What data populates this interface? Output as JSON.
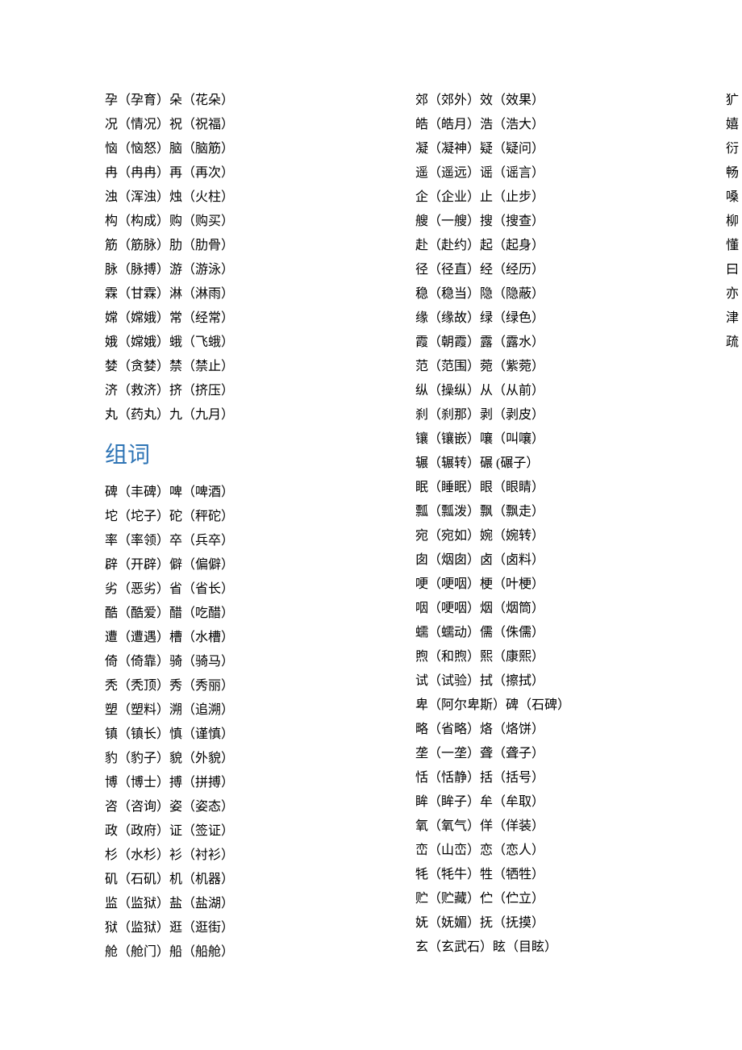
{
  "heading": "组词",
  "section1": [
    "孕（孕育）朵（花朵）",
    "况（情况）祝（祝福）",
    "恼（恼怒）脑（脑筋）",
    "冉（冉冉）再（再次）",
    "浊（浑浊）烛（火柱）",
    "构（构成）购（购买）",
    "筋（筋脉）肋（肋骨）",
    "脉（脉搏）游（游泳）",
    "霖（甘霖）淋（淋雨）",
    "嫦（嫦娥）常（经常）",
    "娥（嫦娥）蛾（飞蛾）",
    "婪（贪婪）禁（禁止）",
    "济（救济）挤（挤压）",
    "丸（药丸）九（九月）"
  ],
  "section2": [
    "碑（丰碑）啤（啤酒）",
    "坨（坨子）砣（秤砣）",
    "率（率领）卒（兵卒）",
    "辟（开辟）僻（偏僻）",
    "劣（恶劣）省（省长）",
    "酷（酷爱）醋（吃醋）",
    "遭（遭遇）槽（水槽）",
    "倚（倚靠）骑（骑马）",
    "秃（秃顶）秀（秀丽）",
    "塑（塑料）溯（追溯）",
    "镇（镇长）慎（谨慎）",
    "豹（豹子）貌（外貌）",
    "博（博士）搏（拼搏）",
    "咨（咨询）姿（姿态）",
    "政（政府）证（签证）",
    "杉（水杉）衫（衬衫）",
    "矶（石矶）机（机器）",
    "监（监狱）盐（盐湖）",
    "狱（监狱）逛（逛街）",
    "舱（舱门）船（船舱）",
    "郊（郊外）效（效果）",
    "皓（皓月）浩（浩大）",
    "凝（凝神）疑（疑问）",
    "遥（遥远）谣（谣言）",
    "企（企业）止（止步）",
    "艘（一艘）搜（搜查）",
    "赴（赴约）起（起身）",
    "径（径直）经（经历）",
    "稳（稳当）隐（隐蔽）",
    "缘（缘故）绿（绿色）",
    "霞（朝霞）露（露水）",
    "范（范围）菀（紫菀）",
    "纵（操纵）从（从前）",
    "刹（刹那）剥（剥皮）",
    "镶（镶嵌）嚷（叫嚷）",
    "辗（辗转）碾  (碾子）",
    "眠（睡眠）眼（眼睛）",
    "瓢（瓢泼）飘（飘走）",
    "宛（宛如）婉（婉转）",
    "囱（烟囱）卤（卤料）",
    "哽（哽咽）梗（叶梗）",
    "咽（哽咽）烟（烟筒）",
    "蠕（蠕动）儒（侏儒）",
    "煦（和煦）熙（康熙）",
    "试（试验）拭（擦拭）",
    "卑（阿尔卑斯）碑（石碑）",
    "略（省略）烙（烙饼）",
    "垄（一垄）聋（聋子）",
    "恬（恬静）括（括号）",
    "眸（眸子）牟（牟取）",
    "氧（氧气）佯（佯装）",
    "峦（山峦）恋（恋人）",
    "牦（牦牛）牲（牺牲）",
    "贮（贮藏）伫（伫立）",
    "妩（妩媚）抚（抚摸）",
    "玄（玄武石）眩（目眩）",
    "犷（粗犷）扩（扩大）",
    "嬉（嬉闹）嘻（嘻哈）",
    "衍（繁衍）衔（衔接）",
    "畅（畅快）杨（杨树）",
    "嗓（嗓音）缀（点缀）",
    "柳（杨柳）抑（抑制）",
    "懂（懂事）憧（憧憬）",
    "曰（子曰）日（日落）",
    "亦（不亦说乎）赤（赤脚）",
    "津（天津）律（法律）",
    "疏（疏密）梳（梳子）"
  ]
}
